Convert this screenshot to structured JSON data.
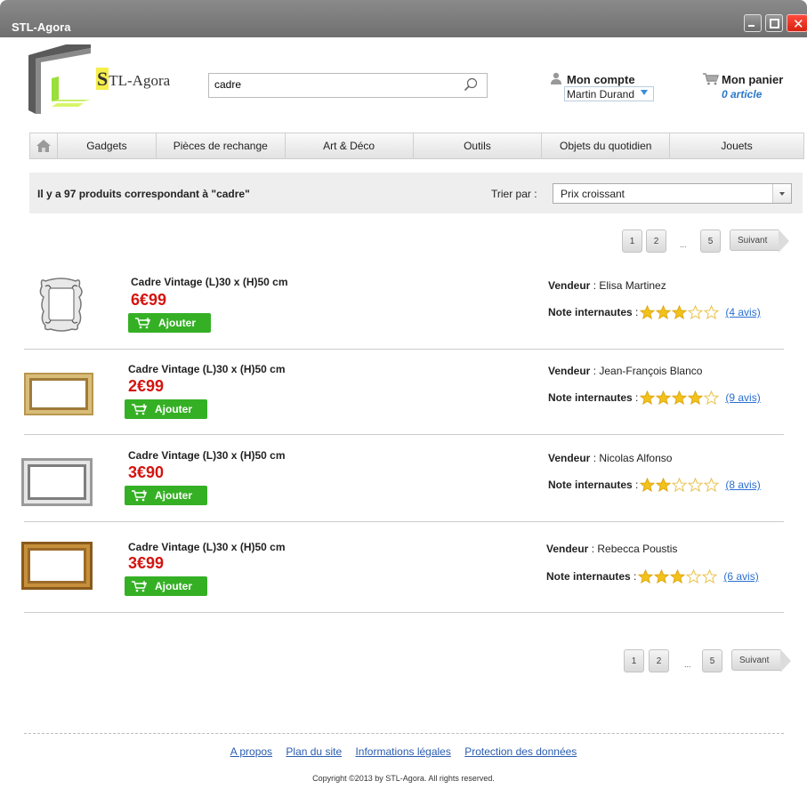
{
  "window": {
    "title": "STL-Agora"
  },
  "header": {
    "logo_initial": "S",
    "logo_rest": "TL-Agora",
    "search_value": "cadre",
    "account_label": "Mon compte",
    "account_user": "Martin Durand",
    "cart_label": "Mon panier",
    "cart_count": "0 article"
  },
  "nav": {
    "items": [
      "Gadgets",
      "Pièces de rechange",
      "Art & Déco",
      "Outils",
      "Objets du quotidien",
      "Jouets"
    ]
  },
  "results": {
    "count_text": "Il y a 97 produits correspondant à \"cadre\"",
    "sort_label": "Trier par :",
    "sort_value": "Prix croissant"
  },
  "pagination": {
    "pages": [
      "1",
      "2",
      "5"
    ],
    "ellipsis": "...",
    "next_label": "Suivant"
  },
  "labels": {
    "add_button": "Ajouter",
    "seller_label": "Vendeur",
    "rating_label": "Note internautes"
  },
  "products": [
    {
      "name": "Cadre Vintage (L)30 x (H)50 cm",
      "price": "6€99",
      "seller": "Elisa Martinez",
      "stars": 3,
      "reviews": "(4 avis)"
    },
    {
      "name": "Cadre Vintage (L)30 x (H)50 cm",
      "price": "2€99",
      "seller": "Jean-François Blanco",
      "stars": 4,
      "reviews": "(9 avis)"
    },
    {
      "name": "Cadre Vintage (L)30 x (H)50 cm",
      "price": "3€90",
      "seller": "Nicolas Alfonso",
      "stars": 2,
      "reviews": "(8 avis)"
    },
    {
      "name": "Cadre Vintage (L)30 x (H)50 cm",
      "price": "3€99",
      "seller": "Rebecca Poustis",
      "stars": 3,
      "reviews": "(6 avis)"
    }
  ],
  "footer": {
    "links": [
      "A propos",
      "Plan du site",
      "Informations légales",
      "Protection des données"
    ],
    "copyright": "Copyright ©2013 by STL-Agora. All rights reserved."
  },
  "colors": {
    "price_red": "#d4140f",
    "add_green": "#35b025",
    "link_blue": "#2a6fd0",
    "star_gold": "#f2c21b"
  }
}
